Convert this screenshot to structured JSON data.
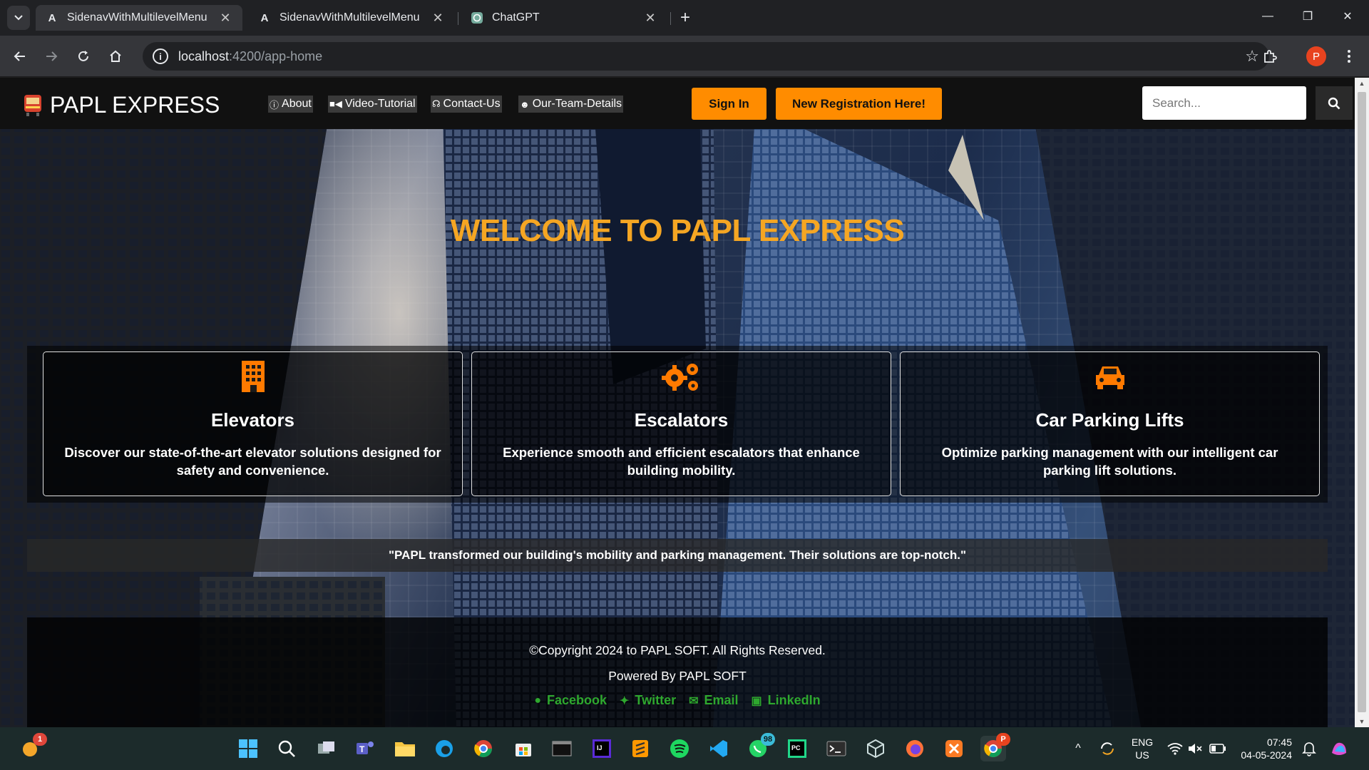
{
  "browser": {
    "tabs": [
      {
        "title": "SidenavWithMultilevelMenu",
        "favicon": "angular-icon",
        "active": true
      },
      {
        "title": "SidenavWithMultilevelMenu",
        "favicon": "angular-icon",
        "active": false
      },
      {
        "title": "ChatGPT",
        "favicon": "chatgpt-icon",
        "active": false
      }
    ],
    "url_host": "localhost",
    "url_rest": ":4200/app-home",
    "profile_initial": "P"
  },
  "site": {
    "brand": "PAPL EXPRESS",
    "nav": [
      {
        "label": "About",
        "icon": "info-icon"
      },
      {
        "label": "Video-Tutorial",
        "icon": "video-icon"
      },
      {
        "label": "Contact-Us",
        "icon": "headset-icon"
      },
      {
        "label": "Our-Team-Details",
        "icon": "users-icon"
      }
    ],
    "sign_in": "Sign In",
    "register": "New Registration Here!",
    "search_placeholder": "Search...",
    "welcome": "WELCOME TO PAPL EXPRESS",
    "cards": [
      {
        "title": "Elevators",
        "text": "Discover our state-of-the-art elevator solutions designed for safety and convenience.",
        "icon": "building-icon"
      },
      {
        "title": "Escalators",
        "text": "Experience smooth and efficient escalators that enhance building mobility.",
        "icon": "gears-icon"
      },
      {
        "title": "Car Parking Lifts",
        "text": "Optimize parking management with our intelligent car parking lift solutions.",
        "icon": "car-icon"
      }
    ],
    "testimonial": "\"PAPL transformed our building's mobility and parking management. Their solutions are top-notch.\"",
    "footer": {
      "copyright": "©Copyright 2024 to PAPL SOFT. All Rights Reserved.",
      "powered": "Powered By PAPL SOFT",
      "social": [
        {
          "label": "Facebook",
          "icon": "facebook-icon"
        },
        {
          "label": "Twitter",
          "icon": "twitter-icon"
        },
        {
          "label": "Email",
          "icon": "envelope-icon"
        },
        {
          "label": "LinkedIn",
          "icon": "linkedin-icon"
        }
      ]
    },
    "colors": {
      "accent": "#ff8c00",
      "welcome": "#f5a623",
      "social": "#2ea82e"
    }
  },
  "taskbar": {
    "widget_badge": "1",
    "whatsapp_badge": "98",
    "chrome_badge": "P",
    "lang_top": "ENG",
    "lang_bottom": "US",
    "time": "07:45",
    "date": "04-05-2024"
  }
}
